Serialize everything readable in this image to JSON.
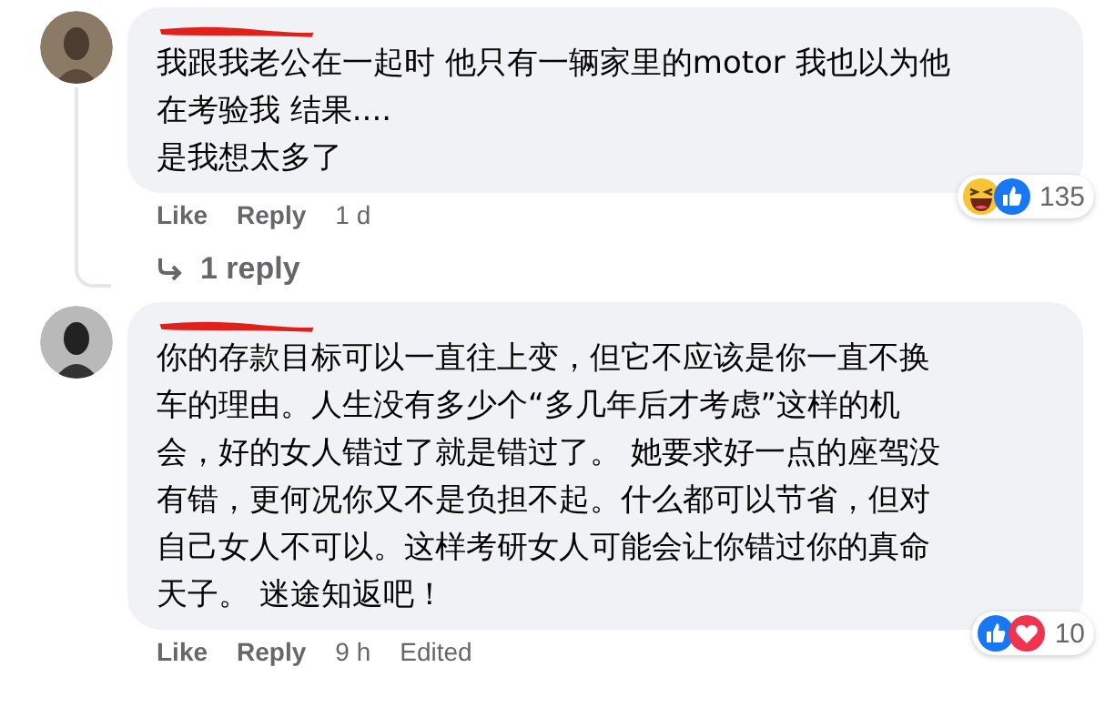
{
  "comments": [
    {
      "lines": [
        "我跟我老公在一起时 他只有一辆家里的motor 我也以为他",
        "在考验我 结果....",
        "是我想太多了"
      ],
      "reactions": [
        {
          "kind": "haha"
        },
        {
          "kind": "like"
        }
      ],
      "reaction_count": "135",
      "actions": [
        "Like",
        "Reply"
      ],
      "time": "1 d",
      "replies_link": "1 reply"
    },
    {
      "lines": [
        "你的存款目标可以一直往上变，但它不应该是你一直不换",
        "车的理由。人生没有多少个“多几年后才考虑”这样的机",
        "会，好的女人错过了就是错过了。 她要求好一点的座驾没",
        "有错，更何况你又不是负担不起。什么都可以节省，但对",
        "自己女人不可以。这样考研女人可能会让你错过你的真命",
        "天子。 迷途知返吧！"
      ],
      "reactions": [
        {
          "kind": "like"
        },
        {
          "kind": "love"
        }
      ],
      "reaction_count": "10",
      "actions": [
        "Like",
        "Reply"
      ],
      "time": "9 h",
      "edited": "Edited"
    }
  ]
}
